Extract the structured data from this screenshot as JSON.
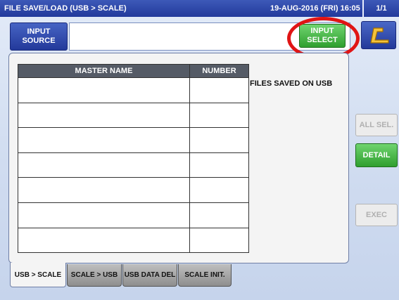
{
  "titlebar": {
    "title": "FILE SAVE/LOAD (USB > SCALE)",
    "datetime": "19-AUG-2016 (FRI) 16:05",
    "page": "1/1"
  },
  "input_source": {
    "label_line1": "INPUT",
    "label_line2": "SOURCE",
    "value": ""
  },
  "input_select": {
    "line1": "INPUT",
    "line2": "SELECT"
  },
  "back_button": {
    "icon": "return-arrow-icon"
  },
  "table": {
    "headers": [
      "MASTER NAME",
      "NUMBER"
    ],
    "rows": [
      [
        "",
        ""
      ],
      [
        "",
        ""
      ],
      [
        "",
        ""
      ],
      [
        "",
        ""
      ],
      [
        "",
        ""
      ],
      [
        "",
        ""
      ],
      [
        "",
        ""
      ]
    ]
  },
  "files_label": "FILES SAVED ON USB",
  "side_buttons": {
    "all_sel": "ALL SEL.",
    "detail": "DETAIL",
    "exec": "EXEC"
  },
  "tabs": [
    "USB > SCALE",
    "SCALE > USB",
    "USB DATA DEL",
    "SCALE INIT."
  ],
  "colors": {
    "title_bar": "#22399b",
    "accent_green": "#2f9f2f",
    "highlight_red": "#e01515",
    "disabled_gray": "#ececec"
  }
}
